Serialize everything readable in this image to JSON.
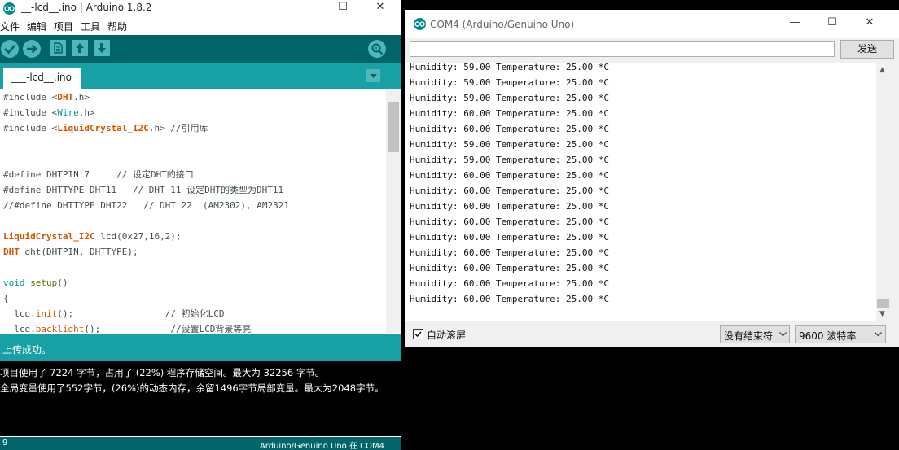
{
  "ide": {
    "title": "__-lcd__.ino | Arduino 1.8.2",
    "menu": [
      "文件",
      "编辑",
      "项目",
      "工具",
      "帮助"
    ],
    "tab_label": "___-lcd__.ino",
    "code_lines": [
      [
        {
          "t": "#include <",
          "c": ""
        },
        {
          "t": "DHT",
          "c": "cls"
        },
        {
          "t": ".h>",
          "c": ""
        }
      ],
      [
        {
          "t": "#include <",
          "c": ""
        },
        {
          "t": "Wire",
          "c": "typ"
        },
        {
          "t": ".h>",
          "c": ""
        }
      ],
      [
        {
          "t": "#include <",
          "c": ""
        },
        {
          "t": "LiquidCrystal_I2C",
          "c": "cls"
        },
        {
          "t": ".h> //引用库",
          "c": ""
        }
      ],
      [],
      [],
      [
        {
          "t": "#define DHTPIN 7     // 设定DHT的接口",
          "c": ""
        }
      ],
      [
        {
          "t": "#define DHTTYPE DHT11   // DHT 11 设定DHT的类型为DHT11",
          "c": ""
        }
      ],
      [
        {
          "t": "//#define DHTTYPE DHT22   // DHT 22  (AM2302), AM2321",
          "c": ""
        }
      ],
      [],
      [
        {
          "t": "LiquidCrystal_I2C",
          "c": "cls"
        },
        {
          "t": " lcd(0x27,16,2);",
          "c": ""
        }
      ],
      [
        {
          "t": "DHT",
          "c": "cls"
        },
        {
          "t": " dht(DHTPIN, DHTTYPE);",
          "c": ""
        }
      ],
      [],
      [
        {
          "t": "void",
          "c": "typ"
        },
        {
          "t": " ",
          "c": ""
        },
        {
          "t": "setup",
          "c": "def"
        },
        {
          "t": "()",
          "c": ""
        }
      ],
      [
        {
          "t": "{",
          "c": ""
        }
      ],
      [
        {
          "t": "  lcd.",
          "c": ""
        },
        {
          "t": "init",
          "c": "fn"
        },
        {
          "t": "();                 // 初始化LCD",
          "c": ""
        }
      ],
      [
        {
          "t": "  lcd.",
          "c": ""
        },
        {
          "t": "backlight",
          "c": "fn"
        },
        {
          "t": "();             //设置LCD背景等亮",
          "c": ""
        }
      ]
    ],
    "status_text": "上传成功。",
    "console_lines": [
      "项目使用了 7224 字节，占用了 (22%) 程序存储空间。最大为 32256 字节。",
      "全局变量使用了552字节，(26%)的动态内存，余留1496字节局部变量。最大为2048字节。"
    ],
    "footer_line": "9",
    "footer_board": "Arduino/Genuino Uno 在 COM4"
  },
  "serial": {
    "title": "COM4 (Arduino/Genuino Uno)",
    "send_label": "发送",
    "send_input_value": "",
    "lines": [
      "Humidity: 59.00 Temperature: 25.00 *C",
      "Humidity: 59.00 Temperature: 25.00 *C",
      "Humidity: 59.00 Temperature: 25.00 *C",
      "Humidity: 60.00 Temperature: 25.00 *C",
      "Humidity: 60.00 Temperature: 25.00 *C",
      "Humidity: 59.00 Temperature: 25.00 *C",
      "Humidity: 59.00 Temperature: 25.00 *C",
      "Humidity: 60.00 Temperature: 25.00 *C",
      "Humidity: 60.00 Temperature: 25.00 *C",
      "Humidity: 60.00 Temperature: 25.00 *C",
      "Humidity: 60.00 Temperature: 25.00 *C",
      "Humidity: 60.00 Temperature: 25.00 *C",
      "Humidity: 60.00 Temperature: 25.00 *C",
      "Humidity: 60.00 Temperature: 25.00 *C",
      "Humidity: 60.00 Temperature: 25.00 *C",
      "Humidity: 60.00 Temperature: 25.00 *C"
    ],
    "autoscroll_label": "自动滚屏",
    "autoscroll_checked": true,
    "line_ending": "没有结束符",
    "baud_rate": "9600 波特率"
  },
  "colors": {
    "ide_toolbar": "#006468",
    "ide_teal": "#17a1a5",
    "button_light": "#4db7bb",
    "keyword_orange": "#d35400"
  },
  "icons": {
    "verify": "check-icon",
    "upload": "arrow-right-icon",
    "new": "file-icon",
    "open": "arrow-up-icon",
    "save": "arrow-down-icon",
    "serial_monitor": "magnifier-icon",
    "tab_menu": "triangle-down-icon"
  }
}
